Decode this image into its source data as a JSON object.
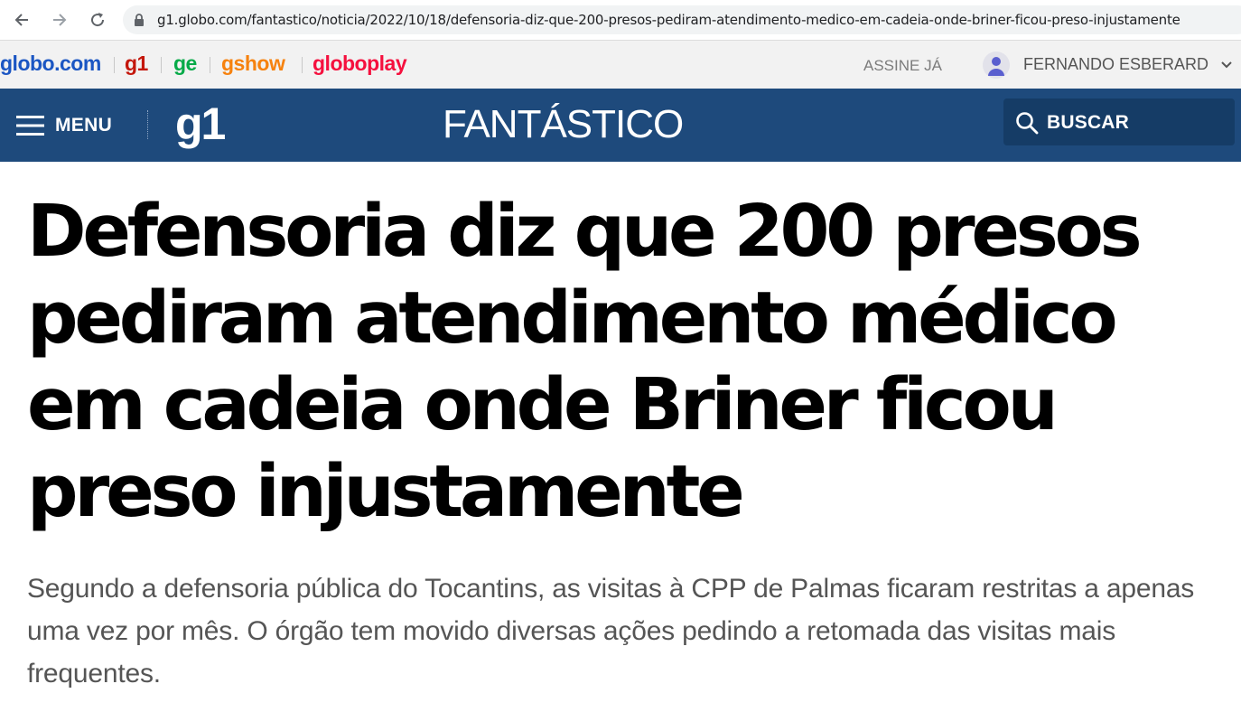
{
  "browser": {
    "url": "g1.globo.com/fantastico/noticia/2022/10/18/defensoria-diz-que-200-presos-pediram-atendimento-medico-em-cadeia-onde-briner-ficou-preso-injustamente"
  },
  "globo_bar": {
    "brands": [
      {
        "label": "globo.com",
        "color": "#1b56c3"
      },
      {
        "label": "g1",
        "color": "#c4170c"
      },
      {
        "label": "ge",
        "color": "#06aa48"
      },
      {
        "label": "gshow",
        "color": "#f6820f"
      },
      {
        "label": "globoplay",
        "color": "#f5103e"
      }
    ],
    "subscribe": "ASSINE JÁ",
    "user_name": "FERNANDO ESBERARD"
  },
  "header": {
    "menu_label": "MENU",
    "logo": "g1",
    "section": "FANTÁSTICO",
    "search_label": "BUSCAR",
    "background": "#1e4a7c"
  },
  "article": {
    "title": "Defensoria diz que 200 presos pediram atendimento médico em cadeia onde Briner ficou preso injustamente",
    "subtitle": "Segundo a defensoria pública do Tocantins, as visitas à CPP de Palmas ficaram restritas a apenas uma vez por mês. O órgão tem movido diversas ações pedindo a retomada das visitas mais frequentes."
  }
}
